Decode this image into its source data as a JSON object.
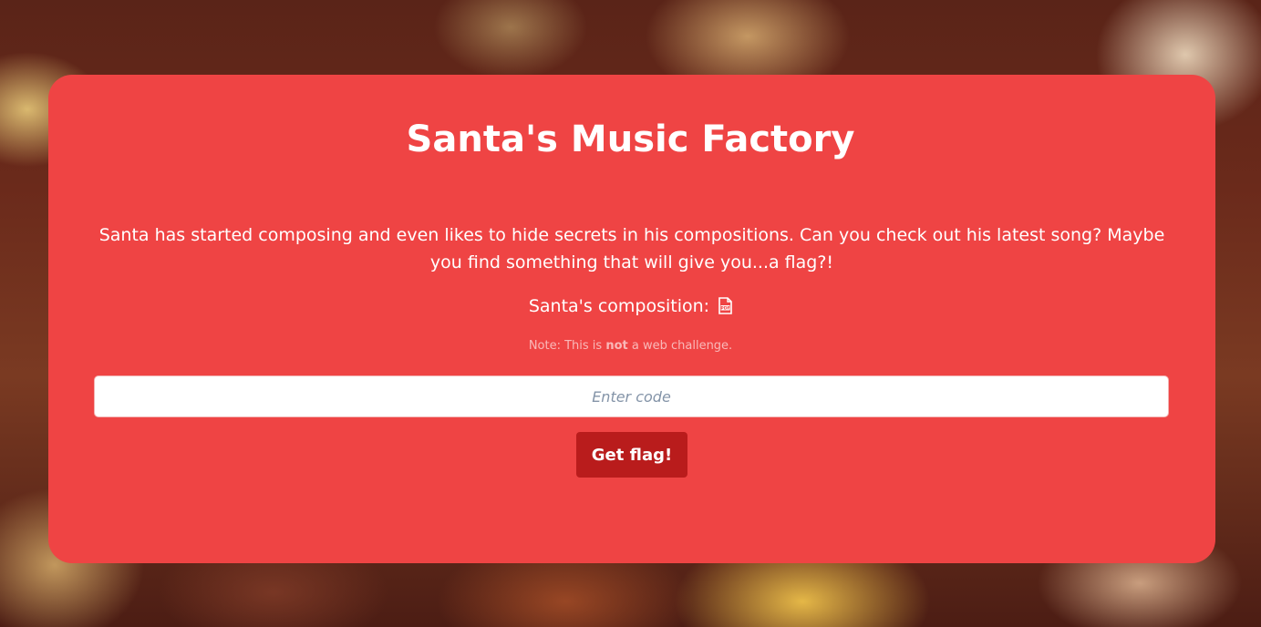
{
  "page": {
    "title": "Santa's Music Factory",
    "description": "Santa has started composing and even likes to hide secrets in his compositions. Can you check out his latest song? Maybe you find something that will give you...a flag?!",
    "composition_label": "Santa's composition:",
    "composition_icon": "pdf-file-icon",
    "note_prefix": "Note: This is",
    "note_emphasis": "not",
    "note_suffix": "a web challenge."
  },
  "form": {
    "code_placeholder": "Enter code",
    "code_value": "",
    "submit_label": "Get flag!"
  },
  "colors": {
    "card": "#ef4444",
    "button": "#b91c1c",
    "text": "#ffffff"
  }
}
